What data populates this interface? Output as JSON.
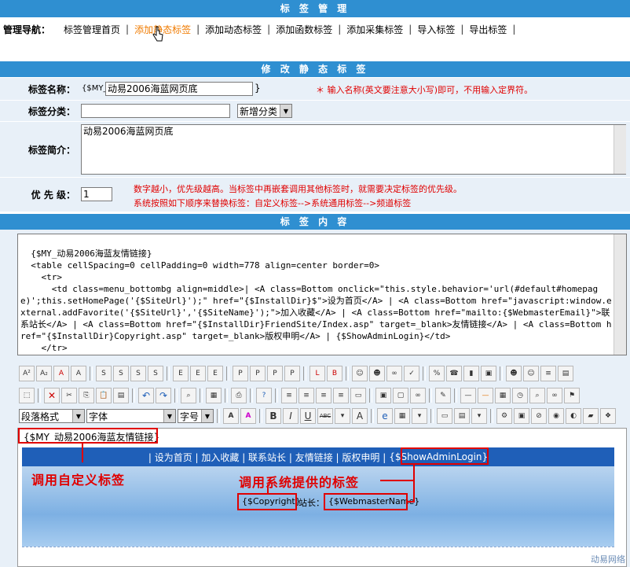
{
  "header": {
    "title": "标 签 管 理"
  },
  "nav": {
    "label": "管理导航：",
    "items": [
      "标签管理首页",
      "添加静态标签",
      "添加动态标签",
      "添加函数标签",
      "添加采集标签",
      "导入标签",
      "导出标签"
    ],
    "active_index": 1
  },
  "form": {
    "section_title": "修 改 静 态 标 签",
    "name_label": "标签名称：",
    "name_prefix": "{$MY_",
    "name_value": "动易2006海蓝网页底",
    "name_suffix": "}",
    "name_hint": "＊ 输入名称(英文要注意大小写)即可，不用输入定界符。",
    "category_label": "标签分类：",
    "category_value": "",
    "category_select": "新增分类",
    "intro_label": "标签简介：",
    "intro_value": "动易2006海蓝网页底",
    "priority_label": "优 先 级：",
    "priority_value": "1",
    "priority_hint_1": "数字越小，优先级越高。当标签中再嵌套调用其他标签时，就需要决定标签的优先级。",
    "priority_hint_2": "系统按照如下顺序来替换标签：自定义标签-->系统通用标签-->频道标签"
  },
  "content": {
    "section_title": "标 签 内 容",
    "code": "{$MY_动易2006海蓝友情链接}\n  <table cellSpacing=0 cellPadding=0 width=778 align=center border=0>\n    <tr>\n      <td class=menu_bottombg align=middle>| <A class=Bottom onclick=\"this.style.behavior='url(#default#homepage)';this.setHomePage('{$SiteUrl}');\" href=\"{$InstallDir}$\">设为首页</A> | <A class=Bottom href=\"javascript:window.external.addFavorite('{$SiteUrl}','{$SiteName}');\">加入收藏</A> | <A class=Bottom href=\"mailto:{$WebmasterEmail}\">联系站长</A> | <A class=Bottom href=\"{$InstallDir}FriendSite/Index.asp\" target=_blank>友情链接</A> | <A class=Bottom href=\"{$InstallDir}Copyright.asp\" target=_blank>版权申明</A> | {$ShowAdminLogin}</td>\n    </tr>"
  },
  "toolbar": {
    "format_select": "段落格式",
    "font_select": "字体",
    "size_select": "字号"
  },
  "preview": {
    "custom_tag": "{$MY_动易2006海蓝友情链接}",
    "band_text": "| 设为首页 | 加入收藏 | 联系站长 | 友情链接 | 版权申明 |",
    "admin_tag": "{$ShowAdminLogin}",
    "copyright_tag": "{$Copyright}",
    "webmaster_label": "站长：",
    "webmaster_tag": "{$WebmasterName}",
    "callout_custom": "调用自定义标签",
    "callout_system": "调用系统提供的标签"
  },
  "watermark": "动易网络",
  "colors": {
    "section_bar": "#2f8fd1",
    "accent": "#f07b00",
    "highlight": "#e00000",
    "row_bg": "#e8f0f8"
  }
}
